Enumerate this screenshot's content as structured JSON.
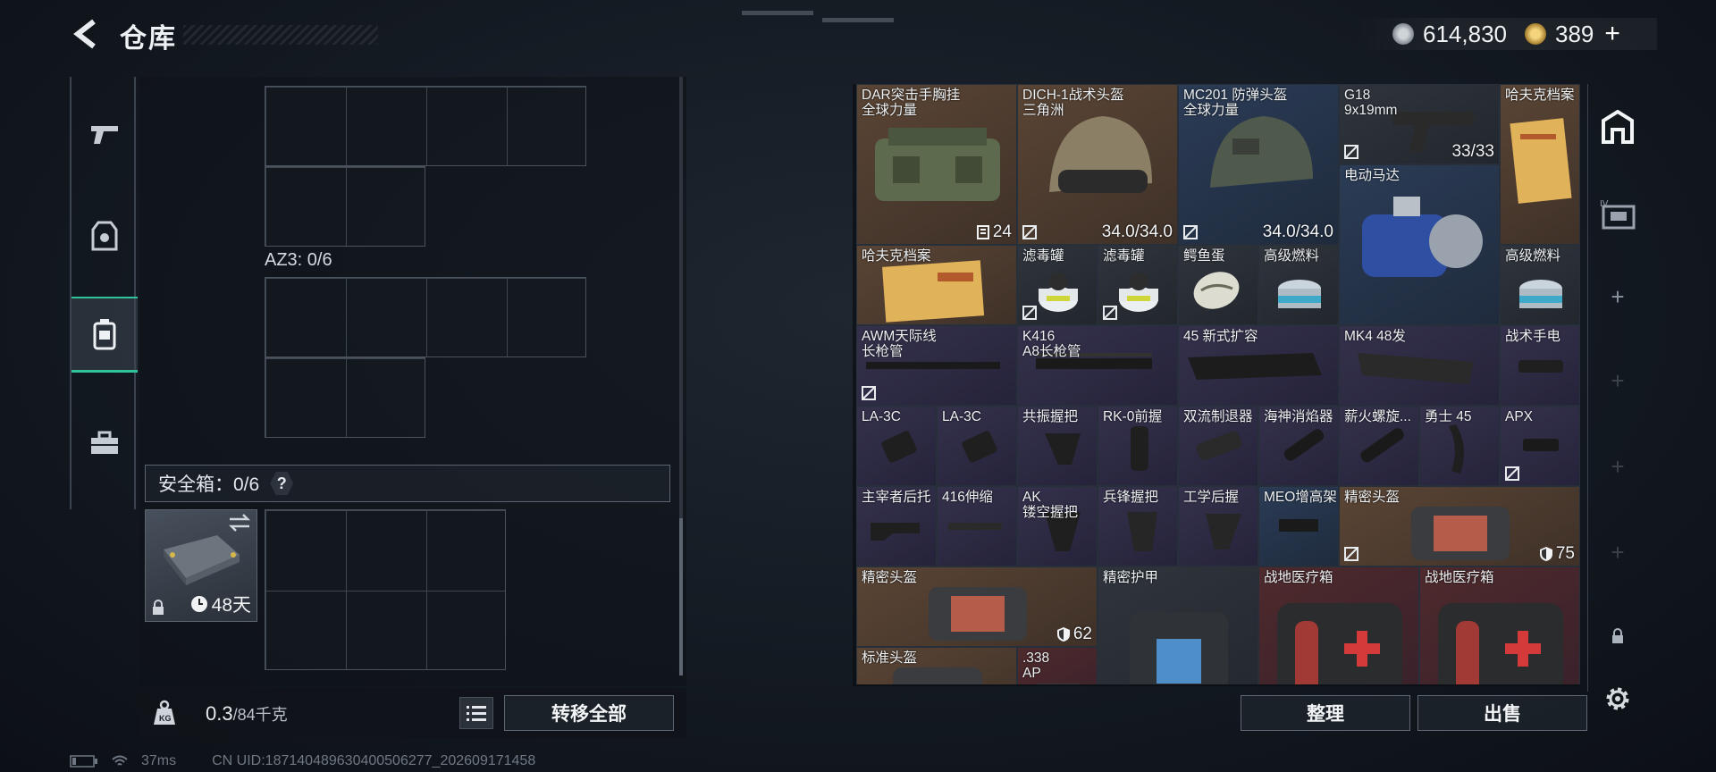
{
  "header": {
    "title": "仓库"
  },
  "currency": {
    "silver": "614,830",
    "gold": "389",
    "add_symbol": "+"
  },
  "left_rail": [
    "weapons-tab",
    "gear-tab",
    "container-tab",
    "toolbox-tab"
  ],
  "backpack": {
    "slot_label": "AZ3: 0/6"
  },
  "safe_box": {
    "label": "安全箱：0/6",
    "help": "?",
    "days": "48天"
  },
  "weight": {
    "current": "0.3",
    "max": "/84千克"
  },
  "buttons": {
    "transfer_all": "转移全部",
    "arrange": "整理",
    "sell": "出售"
  },
  "status": {
    "ping": "37ms",
    "uid": "CN UID:18714048963040050627​7_202609171458"
  },
  "items": [
    {
      "name": "DAR突击手胸挂\n全球力量",
      "value": "24"
    },
    {
      "name": "DICH-1战术头盔\n三角洲",
      "value": "34.0/34.0"
    },
    {
      "name": "MC201 防弹头盔\n全球力量",
      "value": "34.0/34.0"
    },
    {
      "name": "G18\n9x19mm",
      "value": "33/33"
    },
    {
      "name": "哈夫克档案",
      "value": ""
    },
    {
      "name": "电动马达",
      "value": ""
    },
    {
      "name": "哈夫克档案",
      "value": ""
    },
    {
      "name": "滤毒罐",
      "value": ""
    },
    {
      "name": "滤毒罐",
      "value": ""
    },
    {
      "name": "鳄鱼蛋",
      "value": ""
    },
    {
      "name": "高级燃料",
      "value": ""
    },
    {
      "name": "高级燃料",
      "value": ""
    },
    {
      "name": "AWM天际线\n长枪管",
      "value": ""
    },
    {
      "name": "K416\nA8长枪管",
      "value": ""
    },
    {
      "name": "45 新式扩容",
      "value": ""
    },
    {
      "name": "MK4 48发",
      "value": ""
    },
    {
      "name": "战术手电",
      "value": ""
    },
    {
      "name": "LA-3C",
      "value": ""
    },
    {
      "name": "LA-3C",
      "value": ""
    },
    {
      "name": "共振握把",
      "value": ""
    },
    {
      "name": "RK-0前握",
      "value": ""
    },
    {
      "name": "双流制退器",
      "value": ""
    },
    {
      "name": "海神消焰器",
      "value": ""
    },
    {
      "name": "薪火螺旋...",
      "value": ""
    },
    {
      "name": "勇士 45",
      "value": ""
    },
    {
      "name": "APX",
      "value": ""
    },
    {
      "name": "主宰者后托",
      "value": ""
    },
    {
      "name": "416伸缩",
      "value": ""
    },
    {
      "name": "AK\n镂空握把",
      "value": ""
    },
    {
      "name": "兵锋握把",
      "value": ""
    },
    {
      "name": "工学后握",
      "value": ""
    },
    {
      "name": "MEO增高架",
      "value": ""
    },
    {
      "name": "精密头盔",
      "value": "75"
    },
    {
      "name": "精密头盔",
      "value": "62"
    },
    {
      "name": "精密护甲",
      "value": ""
    },
    {
      "name": "战地医疗箱",
      "value": ""
    },
    {
      "name": "战地医疗箱",
      "value": ""
    },
    {
      "name": "标准头盔",
      "value": ""
    },
    {
      "name": ".338\nAP",
      "value": ""
    }
  ]
}
